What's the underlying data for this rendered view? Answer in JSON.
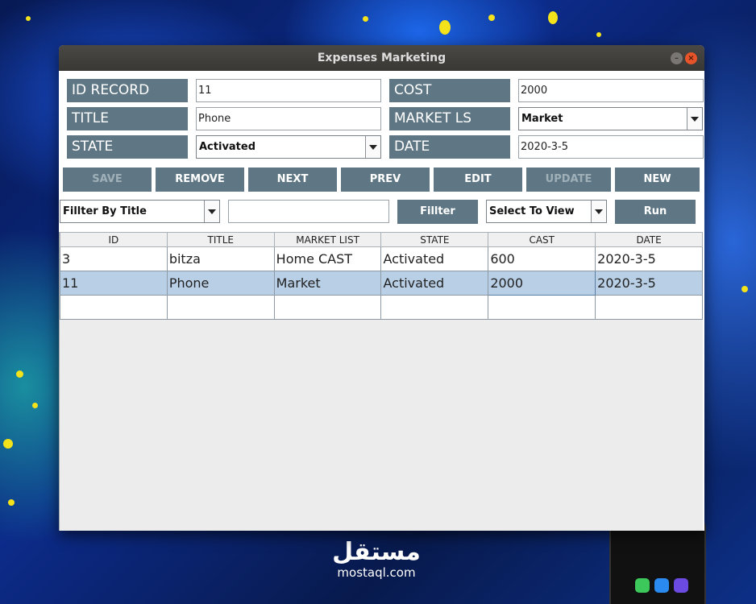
{
  "window": {
    "title": "Expenses Marketing"
  },
  "form": {
    "id_record": {
      "label": "ID RECORD",
      "value": "11"
    },
    "title": {
      "label": "TITLE",
      "value": "Phone"
    },
    "state": {
      "label": "STATE",
      "value": "Activated"
    },
    "cost": {
      "label": "COST",
      "value": "2000"
    },
    "market": {
      "label": "MARKET LS",
      "value": "Market"
    },
    "date": {
      "label": "DATE",
      "value": "2020-3-5"
    }
  },
  "actions": {
    "save": "SAVE",
    "remove": "REMOVE",
    "next": "NEXT",
    "prev": "PREV",
    "edit": "EDIT",
    "update": "UPDATE",
    "new": "NEW"
  },
  "filter": {
    "by": "Fillter By Title",
    "text": "",
    "button": "Fillter",
    "view": "Select To View",
    "run": "Run"
  },
  "table": {
    "columns": [
      "ID",
      "TITLE",
      "MARKET LIST",
      "STATE",
      "CAST",
      "DATE"
    ],
    "rows": [
      [
        "3",
        "bitza",
        "Home CAST",
        "Activated",
        "600",
        "2020-3-5"
      ],
      [
        "11",
        "Phone",
        "Market",
        "Activated",
        "2000",
        "2020-3-5"
      ],
      [
        "",
        "",
        "",
        "",
        "",
        ""
      ]
    ]
  },
  "watermark": {
    "arabic": "مستقل",
    "latin": "mostaql.com"
  },
  "colors": {
    "panel": "#5f7784",
    "selected_row": "#b8cfe5",
    "titlebar": "#3e3c38",
    "close_button": "#e8542a"
  }
}
